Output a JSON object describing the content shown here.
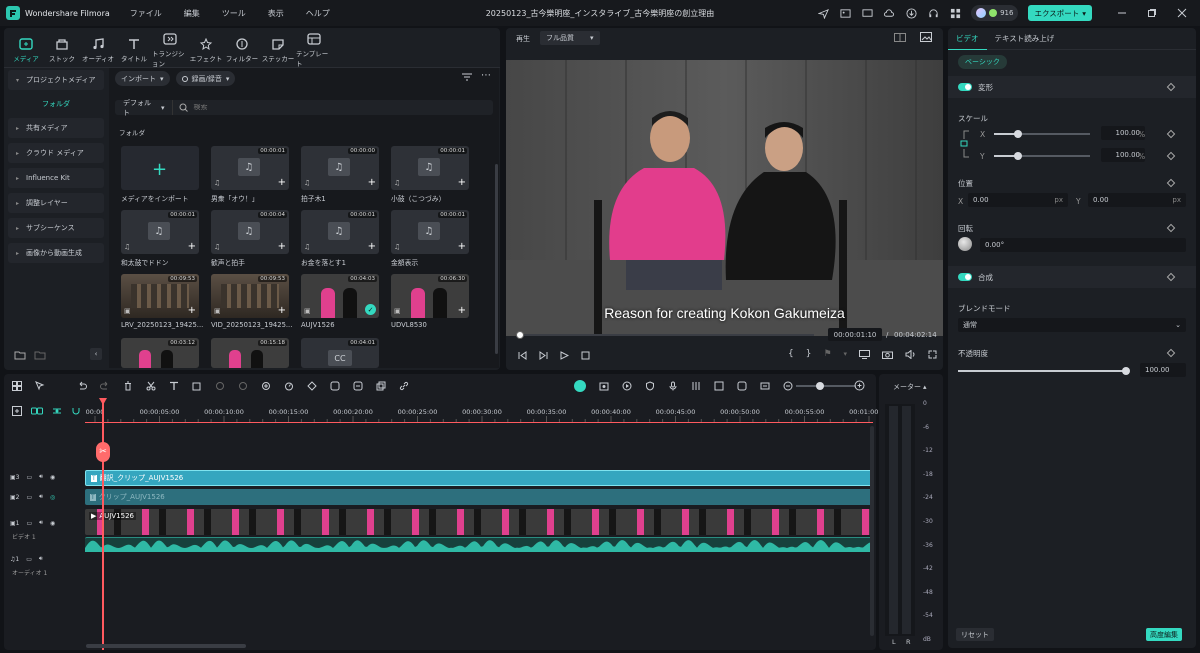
{
  "app": {
    "name": "Wondershare Filmora",
    "document_title": "20250123_古今樂明座_インスタライブ_古今樂明座の創立理由",
    "credits": "916",
    "export_label": "エクスポート"
  },
  "menu": [
    "ファイル",
    "編集",
    "ツール",
    "表示",
    "ヘルプ"
  ],
  "media_tabs": [
    {
      "label": "メディア",
      "icon": "media-icon",
      "active": true
    },
    {
      "label": "ストック",
      "icon": "stock-icon"
    },
    {
      "label": "オーディオ",
      "icon": "music-note-icon"
    },
    {
      "label": "タイトル",
      "icon": "title-t-icon"
    },
    {
      "label": "トランジション",
      "icon": "transition-icon"
    },
    {
      "label": "エフェクト",
      "icon": "effects-icon"
    },
    {
      "label": "フィルター",
      "icon": "filter-icon"
    },
    {
      "label": "ステッカー",
      "icon": "sticker-icon"
    },
    {
      "label": "テンプレート",
      "icon": "template-icon"
    }
  ],
  "sidebar": {
    "project_media": "プロジェクトメディア",
    "folder": "フォルダ",
    "items": [
      "共有メディア",
      "クラウド メディア",
      "Influence Kit",
      "調整レイヤー",
      "サブシーケンス",
      "画像から動画生成"
    ]
  },
  "media_toolbar": {
    "import": "インポート",
    "record": "録画/録音",
    "sort": "デフォルト",
    "search_placeholder": "検索",
    "folder_heading": "フォルダ"
  },
  "media_items": [
    {
      "name": "メディアをインポート",
      "type": "import"
    },
    {
      "name": "男衆「オウ！」",
      "duration": "00:00:01",
      "type": "audio"
    },
    {
      "name": "拍子木1",
      "duration": "00:00:00",
      "type": "audio"
    },
    {
      "name": "小鼓（こつづみ）",
      "duration": "00:00:01",
      "type": "audio"
    },
    {
      "name": "和太鼓でドドン",
      "duration": "00:00:01",
      "type": "audio"
    },
    {
      "name": "歓声と拍手",
      "duration": "00:00:04",
      "type": "audio"
    },
    {
      "name": "お金を落とす1",
      "duration": "00:00:01",
      "type": "audio"
    },
    {
      "name": "金額表示",
      "duration": "00:00:01",
      "type": "audio"
    },
    {
      "name": "LRV_20250123_19425...",
      "duration": "00:09:53",
      "type": "video"
    },
    {
      "name": "VID_20250123_19425...",
      "duration": "00:09:53",
      "type": "video"
    },
    {
      "name": "AUJV1526",
      "duration": "00:04:03",
      "type": "video2",
      "used": true
    },
    {
      "name": "UDVL8530",
      "duration": "00:06:30",
      "type": "video2"
    },
    {
      "name": "",
      "duration": "00:03:12",
      "type": "video2"
    },
    {
      "name": "",
      "duration": "00:15:18",
      "type": "video2"
    },
    {
      "name": "",
      "duration": "00:04:01",
      "type": "cc"
    }
  ],
  "preview": {
    "label": "再生",
    "quality": "フル品質",
    "subtitle": "Reason for creating Kokon Gakumeiza",
    "current_time": "00:00:01:10",
    "separator": "/",
    "total_time": "00:04:02:14"
  },
  "props": {
    "tabs": [
      "ビデオ",
      "テキスト読み上げ"
    ],
    "basic": "ベーシック",
    "transform": "変形",
    "scale": "スケール",
    "x": "X",
    "y": "Y",
    "scale_x": "100.00",
    "scale_y": "100.00",
    "percent": "%",
    "position": "位置",
    "pos_x": "0.00",
    "pos_y": "0.00",
    "px": "px",
    "rotation": "回転",
    "rotation_value": "0.00°",
    "composite": "合成",
    "blend_mode": "ブレンドモード",
    "blend_value": "通常",
    "opacity": "不透明度",
    "opacity_value": "100.00",
    "reset": "リセット",
    "advanced": "高度編集"
  },
  "timeline": {
    "ruler": [
      "00:00",
      "00:00:05:00",
      "00:00:10:00",
      "00:00:15:00",
      "00:00:20:00",
      "00:00:25:00",
      "00:00:30:00",
      "00:00:35:00",
      "00:00:40:00",
      "00:00:45:00",
      "00:00:50:00",
      "00:00:55:00",
      "00:01:00:00"
    ],
    "tracks": [
      {
        "num": "3",
        "clip": "翻訳_クリップ_AUJV1526",
        "color": "#35a6bf"
      },
      {
        "num": "2",
        "clip": "クリップ_AUJV1526",
        "color": "#2d7c8c"
      },
      {
        "num": "1",
        "clip": "AUJV1526",
        "label": "ビデオ 1"
      },
      {
        "num": "1",
        "label": "オーディオ 1"
      }
    ]
  },
  "meter": {
    "title": "メーター",
    "labels": [
      "0",
      "-6",
      "-12",
      "-18",
      "-24",
      "-30",
      "-36",
      "-42",
      "-48",
      "-54",
      "dB"
    ],
    "channels": [
      "L",
      "R"
    ]
  }
}
